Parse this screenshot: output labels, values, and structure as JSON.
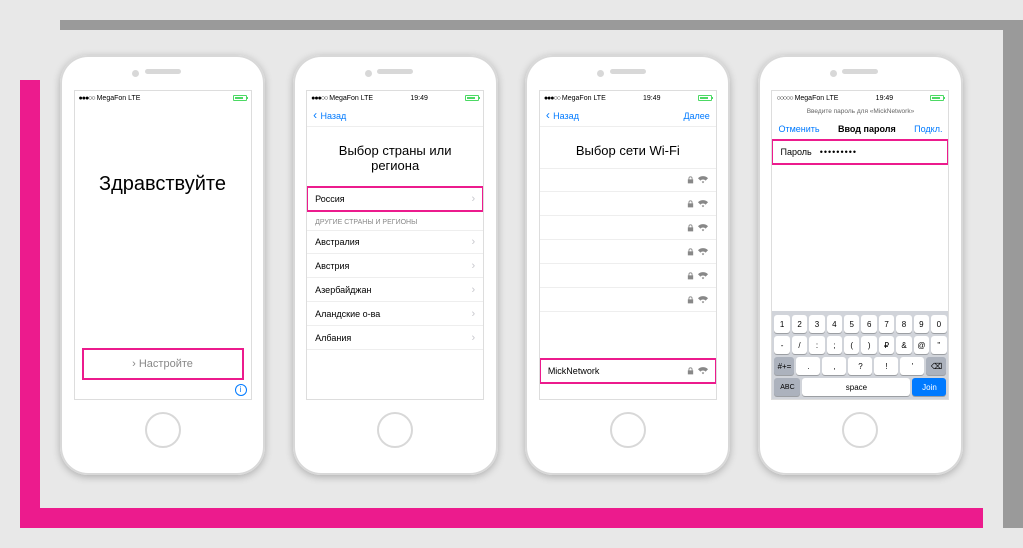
{
  "status": {
    "carrier": "MegaFon",
    "net": "LTE",
    "time": "19:49"
  },
  "screen1": {
    "hello": "Здравствуйте",
    "setup": "Настройте"
  },
  "screen2": {
    "back": "Назад",
    "title": "Выбор страны или региона",
    "featured": "Россия",
    "section_header": "ДРУГИЕ СТРАНЫ И РЕГИОНЫ",
    "countries": [
      "Австралия",
      "Австрия",
      "Азербайджан",
      "Аландские о-ва",
      "Албания"
    ]
  },
  "screen3": {
    "back": "Назад",
    "next": "Далее",
    "title": "Выбор сети Wi-Fi",
    "selected": "MickNetwork"
  },
  "screen4": {
    "subtitle": "Введите пароль для «MickNetwork»",
    "cancel": "Отменить",
    "title": "Ввод пароля",
    "connect": "Подкл.",
    "password_label": "Пароль",
    "password_masked": "•••••••••",
    "keyboard": {
      "row1": [
        "1",
        "2",
        "3",
        "4",
        "5",
        "6",
        "7",
        "8",
        "9",
        "0"
      ],
      "row2": [
        "-",
        "/",
        ":",
        ";",
        "(",
        ")",
        "₽",
        "&",
        "@",
        "\""
      ],
      "row3_left": "#+=",
      "row3": [
        ".",
        ",",
        "?",
        "!",
        "'"
      ],
      "row3_right": "⌫",
      "abc": "ABC",
      "space": "space",
      "join": "Join"
    }
  }
}
